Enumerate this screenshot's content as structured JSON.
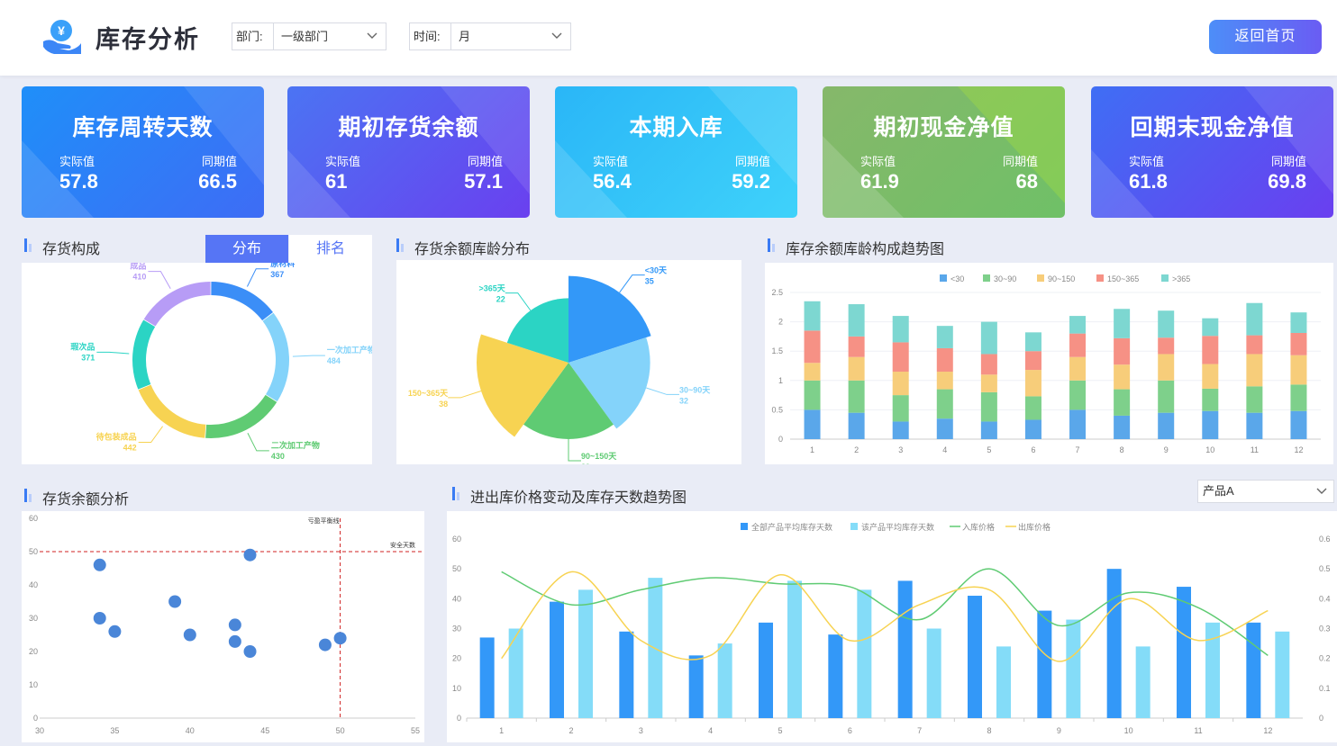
{
  "header": {
    "title": "库存分析",
    "dept_label": "部门:",
    "dept_value": "一级部门",
    "time_label": "时间:",
    "time_value": "月",
    "back_label": "返回首页"
  },
  "colors": {
    "accent": "#5675f5",
    "blue": "#3398f8",
    "lightblue": "#84dcf8",
    "green": "#5fcb73",
    "yellow": "#f7d352",
    "purple": "#b79cf6",
    "teal": "#2bd4c4"
  },
  "kpis": [
    {
      "title": "库存周转天数",
      "actual_label": "实际值",
      "prev_label": "同期值",
      "actual": "57.8",
      "prev": "66.5"
    },
    {
      "title": "期初存货余额",
      "actual_label": "实际值",
      "prev_label": "同期值",
      "actual": "61",
      "prev": "57.1"
    },
    {
      "title": "本期入库",
      "actual_label": "实际值",
      "prev_label": "同期值",
      "actual": "56.4",
      "prev": "59.2"
    },
    {
      "title": "期初现金净值",
      "actual_label": "实际值",
      "prev_label": "同期值",
      "actual": "61.9",
      "prev": "68"
    },
    {
      "title": "回期末现金净值",
      "actual_label": "实际值",
      "prev_label": "同期值",
      "actual": "61.8",
      "prev": "69.8"
    }
  ],
  "sections": {
    "composition": "存货构成",
    "tab_dist": "分布",
    "tab_rank": "排名",
    "age_dist": "存货余额库龄分布",
    "age_trend": "库存余额库龄构成趋势图",
    "balance": "存货余额分析",
    "price_trend": "进出库价格变动及库存天数趋势图",
    "product_select": "产品A"
  },
  "chart_data": [
    {
      "type": "pie",
      "variant": "donut",
      "slices": [
        {
          "name": "原材料",
          "value": 367,
          "color": "#3b8ef7"
        },
        {
          "name": "一次加工产物",
          "value": 484,
          "color": "#84d3fa"
        },
        {
          "name": "二次加工产物",
          "value": 430,
          "color": "#5fcb73"
        },
        {
          "name": "待包装成品",
          "value": 442,
          "color": "#f7d352"
        },
        {
          "name": "瑕次品",
          "value": 371,
          "color": "#2bd4c4"
        },
        {
          "name": "成品",
          "value": 410,
          "color": "#b79cf6"
        }
      ]
    },
    {
      "type": "pie",
      "variant": "rose",
      "slices": [
        {
          "name": "<30天",
          "value": 35,
          "color": "#3398f8"
        },
        {
          "name": "30~90天",
          "value": 32,
          "color": "#84d3fa"
        },
        {
          "name": "90~150天",
          "value": 29,
          "color": "#5fcb73"
        },
        {
          "name": "150~365天",
          "value": 38,
          "color": "#f7d352"
        },
        {
          "name": ">365天",
          "value": 22,
          "color": "#2bd4c4"
        }
      ]
    },
    {
      "type": "bar",
      "stacked": true,
      "categories": [
        "1",
        "2",
        "3",
        "4",
        "5",
        "6",
        "7",
        "8",
        "9",
        "10",
        "11",
        "12"
      ],
      "ylim": [
        0,
        2.5
      ],
      "yticks": [
        "0",
        "0.5",
        "1",
        "1.5",
        "2",
        "2.5"
      ],
      "legend_position": "top",
      "series": [
        {
          "name": "<30",
          "color": "#5aa7ea",
          "values": [
            0.5,
            0.45,
            0.3,
            0.35,
            0.3,
            0.33,
            0.5,
            0.4,
            0.45,
            0.48,
            0.45,
            0.48
          ]
        },
        {
          "name": "30~90",
          "color": "#7ed08b",
          "values": [
            0.5,
            0.55,
            0.45,
            0.5,
            0.5,
            0.4,
            0.5,
            0.45,
            0.55,
            0.38,
            0.45,
            0.45
          ]
        },
        {
          "name": "90~150",
          "color": "#f7cd7a",
          "values": [
            0.3,
            0.4,
            0.4,
            0.3,
            0.3,
            0.45,
            0.4,
            0.42,
            0.45,
            0.42,
            0.55,
            0.5
          ]
        },
        {
          "name": "150~365",
          "color": "#f69185",
          "values": [
            0.55,
            0.35,
            0.5,
            0.4,
            0.35,
            0.32,
            0.4,
            0.45,
            0.28,
            0.48,
            0.32,
            0.38
          ]
        },
        {
          "name": ">365",
          "color": "#7dd7d1",
          "values": [
            0.5,
            0.55,
            0.45,
            0.38,
            0.55,
            0.32,
            0.3,
            0.5,
            0.46,
            0.3,
            0.55,
            0.35
          ]
        }
      ]
    },
    {
      "type": "scatter",
      "xlim": [
        30,
        55
      ],
      "ylim": [
        0,
        60
      ],
      "xticks": [
        "30",
        "35",
        "40",
        "45",
        "50",
        "55"
      ],
      "yticks": [
        "0",
        "10",
        "20",
        "30",
        "40",
        "50",
        "60"
      ],
      "vline": {
        "x": 50,
        "label": "亏盈平衡线"
      },
      "hline": {
        "y": 50,
        "label": "安全天数"
      },
      "points": [
        [
          34,
          46
        ],
        [
          34,
          30
        ],
        [
          35,
          26
        ],
        [
          39,
          35
        ],
        [
          40,
          25
        ],
        [
          43,
          28
        ],
        [
          43,
          23
        ],
        [
          44,
          20
        ],
        [
          44,
          49
        ],
        [
          49,
          22
        ],
        [
          50,
          24
        ]
      ]
    },
    {
      "type": "bar",
      "combo": true,
      "categories": [
        "1",
        "2",
        "3",
        "4",
        "5",
        "6",
        "7",
        "8",
        "9",
        "10",
        "11",
        "12"
      ],
      "ylim": [
        0,
        60
      ],
      "y2lim": [
        0,
        0.6
      ],
      "yticks": [
        "0",
        "10",
        "20",
        "30",
        "40",
        "50",
        "60"
      ],
      "y2ticks": [
        "0",
        "0.1",
        "0.2",
        "0.3",
        "0.4",
        "0.5",
        "0.6"
      ],
      "legend_position": "top",
      "series": [
        {
          "name": "全部产品平均库存天数",
          "kind": "bar",
          "color": "#3398f8",
          "values": [
            27,
            39,
            29,
            21,
            32,
            28,
            46,
            41,
            36,
            50,
            44,
            32
          ]
        },
        {
          "name": "该产品平均库存天数",
          "kind": "bar",
          "color": "#84dcf8",
          "values": [
            30,
            43,
            47,
            25,
            46,
            43,
            30,
            24,
            33,
            24,
            32,
            29
          ]
        },
        {
          "name": "入库价格",
          "kind": "line",
          "axis": "right",
          "color": "#5fcb73",
          "values": [
            0.49,
            0.38,
            0.43,
            0.47,
            0.45,
            0.44,
            0.33,
            0.5,
            0.31,
            0.42,
            0.37,
            0.21
          ]
        },
        {
          "name": "出库价格",
          "kind": "line",
          "axis": "right",
          "color": "#f7d352",
          "values": [
            0.2,
            0.49,
            0.26,
            0.21,
            0.48,
            0.26,
            0.38,
            0.43,
            0.19,
            0.4,
            0.26,
            0.36
          ]
        }
      ]
    }
  ]
}
